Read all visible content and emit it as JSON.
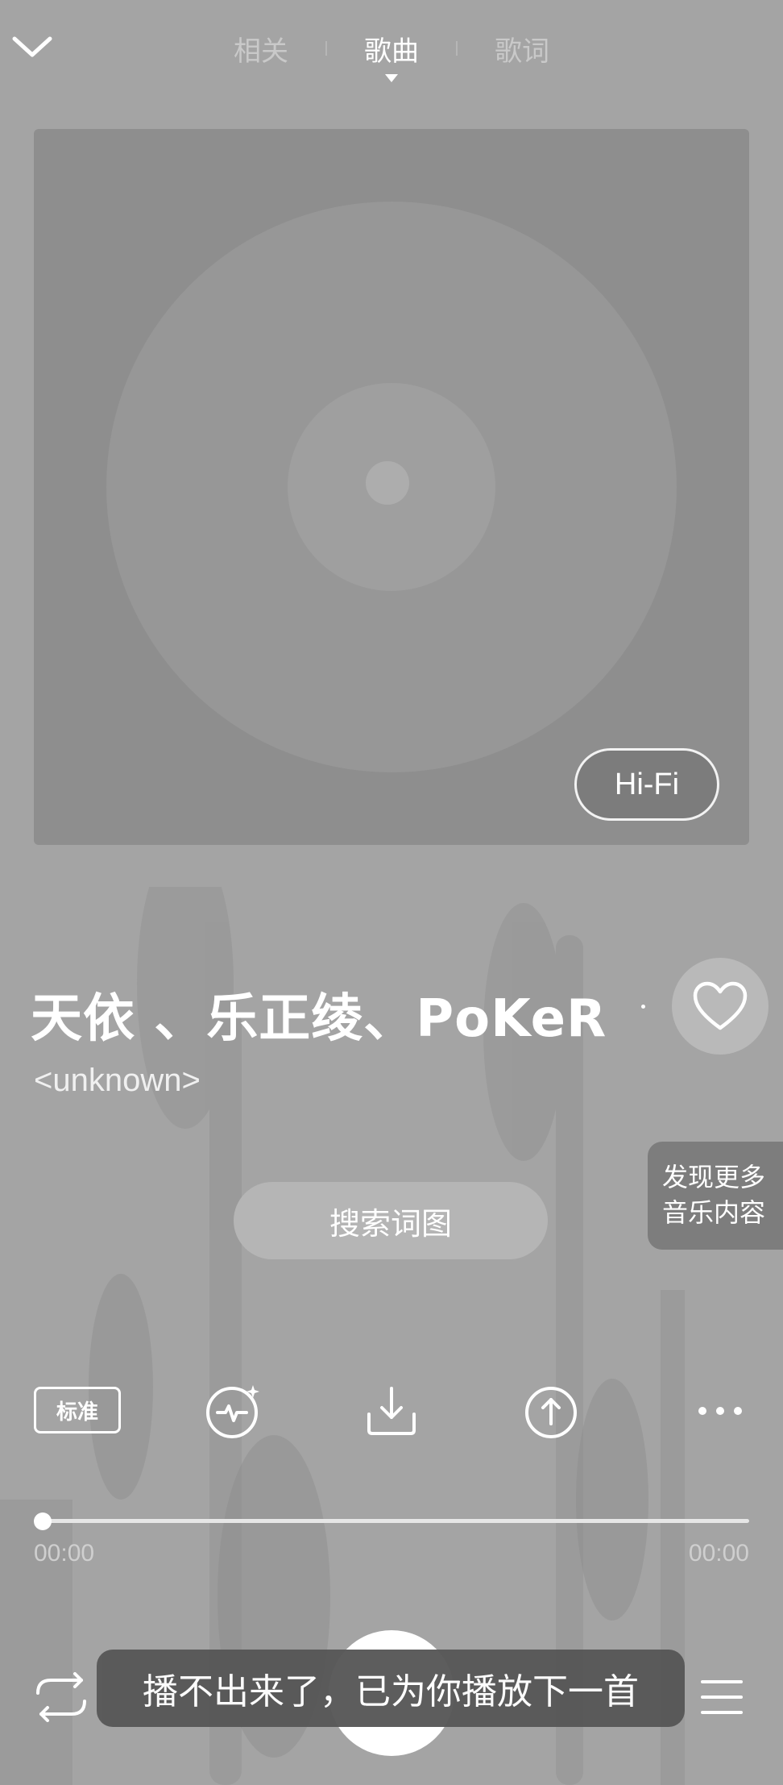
{
  "header": {
    "tabs": [
      {
        "label": "相关",
        "active": false
      },
      {
        "label": "歌曲",
        "active": true
      },
      {
        "label": "歌词",
        "active": false
      }
    ]
  },
  "album": {
    "badge": "Hi-Fi"
  },
  "song": {
    "title": "天依 、乐正绫、PoKeR",
    "artist": "<unknown>"
  },
  "discover": {
    "line1": "发现更多",
    "line2": "音乐内容"
  },
  "search_button": "搜索词图",
  "actions": {
    "quality_label": "标准",
    "icons": [
      "sound-effect-icon",
      "download-icon",
      "share-icon",
      "more-icon"
    ]
  },
  "progress": {
    "current": "00:00",
    "total": "00:00",
    "fraction": 0
  },
  "toast": "播不出来了，已为你播放下一首",
  "colors": {
    "background": "#a4a4a4",
    "album_bg": "#8e8e8e",
    "toast_bg": "#575757"
  }
}
